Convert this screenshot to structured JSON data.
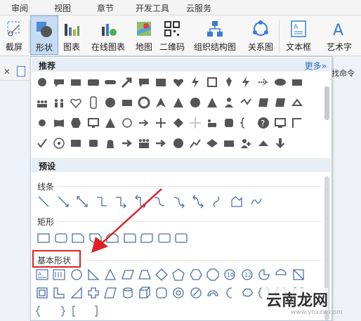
{
  "menu": [
    "审阅",
    "视图",
    "章节",
    "开发工具",
    "云服务"
  ],
  "ribbon": {
    "screenshot": "截屏",
    "shapes": "形状",
    "chart": "图表",
    "online_chart": "在线图表",
    "map": "地图",
    "qrcode": "二维码",
    "org_chart": "组织结构图",
    "relation_chart": "关系图",
    "textbox": "文本框",
    "wordart": "艺术字"
  },
  "side_text": "找命令",
  "panel": {
    "recommended": "推荐",
    "more": "更多»",
    "presets": "预设",
    "lines": "线条",
    "rectangles": "矩形",
    "basic_shapes": "基本形状"
  },
  "watermark": {
    "text": "云南龙网",
    "url": "www.ynxzw.com"
  },
  "colors": {
    "accent": "#2a6cc8",
    "icon": "#555555",
    "highlight_box": "#e02020"
  }
}
